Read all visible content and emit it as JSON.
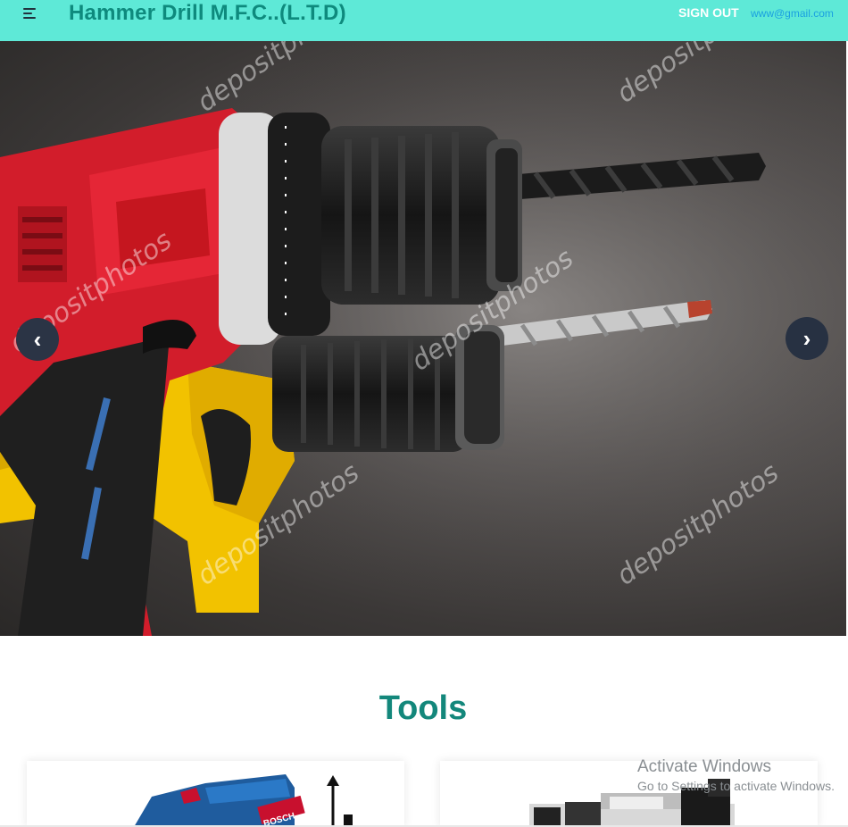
{
  "header": {
    "brand": "Hammer Drill M.F.C..(L.T.D)",
    "signout_label": "SIGN OUT",
    "email": "www@gmail.com"
  },
  "carousel": {
    "prev_label": "‹",
    "next_label": "›",
    "watermark_text": "depositphotos"
  },
  "tools_section": {
    "title": "Tools",
    "card1_brand": "BOSCH"
  },
  "os_watermark": {
    "title": "Activate Windows",
    "subtitle": "Go to Settings to activate Windows."
  },
  "colors": {
    "header_bg": "#5ee9d7",
    "brand_text": "#0e8a7d",
    "section_title": "#13877b",
    "carousel_button": "#273142"
  }
}
